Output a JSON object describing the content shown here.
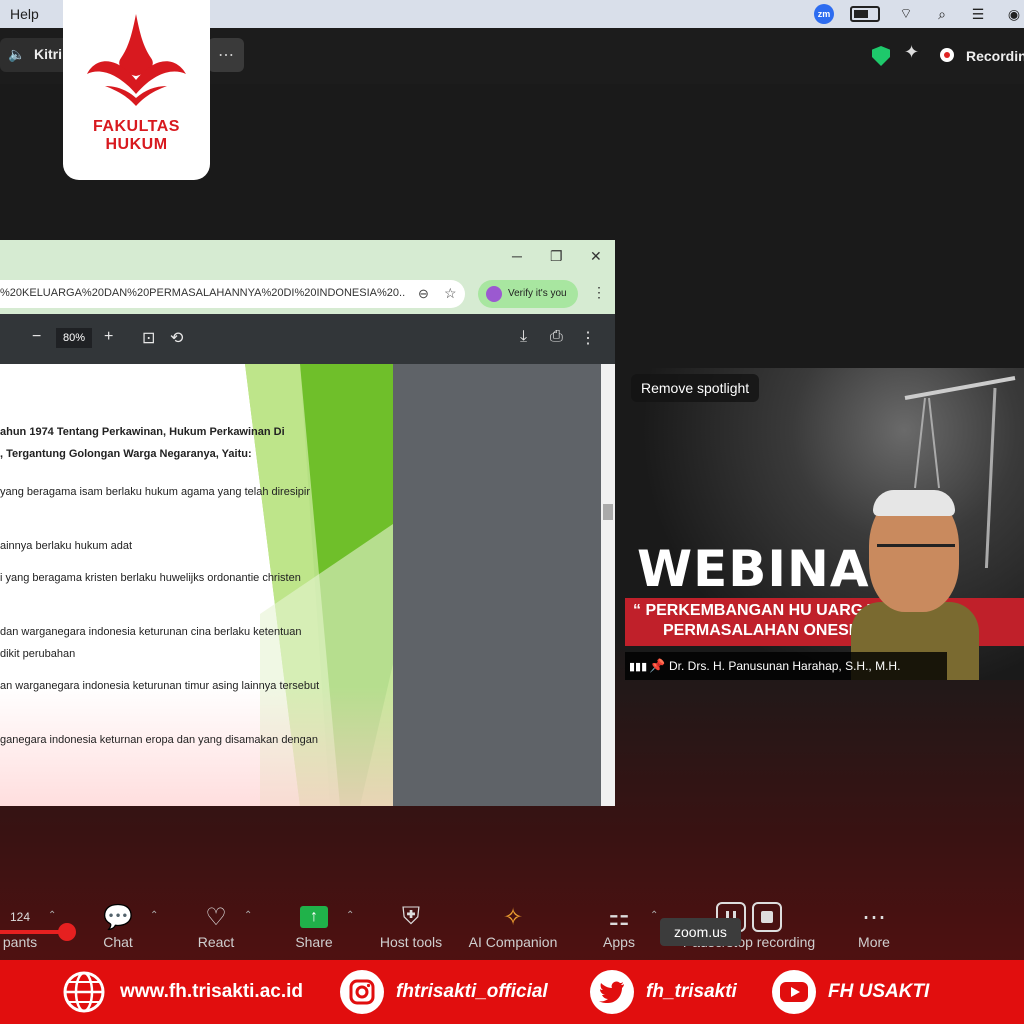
{
  "menubar": {
    "help": "Help",
    "zoom_badge": "zm"
  },
  "zoom_header": {
    "meeting_name": "Kitri",
    "recording": "Recordin"
  },
  "logo": {
    "line1": "FAKULTAS",
    "line2": "HUKUM"
  },
  "browser": {
    "url": "%20KELUARGA%20DAN%20PERMASALAHANNYA%20DI%20INDONESIA%20...",
    "verify": "Verify it's you",
    "zoom": "80%",
    "pdf_lines": [
      "ahun 1974 Tentang Perkawinan, Hukum Perkawinan Di",
      ", Tergantung Golongan Warga Negaranya, Yaitu:",
      "yang beragama isam berlaku hukum agama yang telah diresipir",
      "ainnya berlaku hukum  adat",
      "i yang beragama kristen berlaku huwelijks ordonantie christen",
      "dan warganegara indonesia keturunan  cina berlaku ketentuan",
      "dikit perubahan",
      "an warganegara indonesia keturunan timur asing lainnya tersebut",
      "ganegara indonesia keturnan eropa dan yang disamakan dengan"
    ]
  },
  "video": {
    "remove_spotlight": "Remove spotlight",
    "webinar": "WEBINA",
    "banner_line1": "“ PERKEMBANGAN HU       UARGA I",
    "banner_line2": "PERMASALAHAN        ONESIA",
    "speaker_name": "Dr. Drs. H. Panusunan Harahap, S.H., M.H."
  },
  "toolbar": {
    "participants_count": "124",
    "participants": "pants",
    "chat": "Chat",
    "react": "React",
    "share": "Share",
    "host_tools": "Host tools",
    "ai_companion": "AI Companion",
    "apps": "Apps",
    "recording": "Pause/stop recording",
    "more": "More",
    "tooltip": "zoom.us"
  },
  "footer": {
    "website": "www.fh.trisakti.ac.id",
    "instagram": "fhtrisakti_official",
    "twitter": "fh_trisakti",
    "youtube": "FH USAKTI"
  },
  "colors": {
    "brand_red": "#e10e0e",
    "zoom_green": "#20b24a",
    "browser_chrome": "#d6ebd2"
  }
}
